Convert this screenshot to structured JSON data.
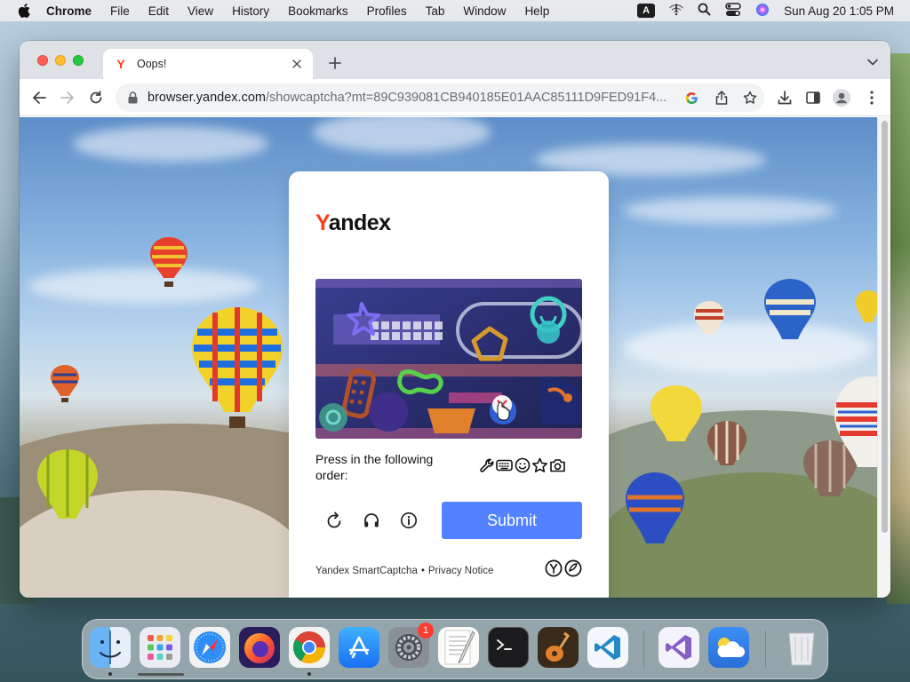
{
  "menubar": {
    "app_name": "Chrome",
    "menus": [
      "File",
      "Edit",
      "View",
      "History",
      "Bookmarks",
      "Profiles",
      "Tab",
      "Window",
      "Help"
    ],
    "input_source": "A",
    "clock": "Sun Aug 20  1:05 PM"
  },
  "tab": {
    "title": "Oops!",
    "favicon": "Y"
  },
  "address_bar": {
    "host": "browser.yandex.com",
    "path": "/showcaptcha?mt=89C939081CB940185E01AAC85111D9FED91F4..."
  },
  "captcha": {
    "logo_first": "Y",
    "logo_rest": "andex",
    "instruction": "Press in the following order:",
    "order_icons": [
      "wrench-icon",
      "keyboard-icon",
      "smiley-icon",
      "star-icon",
      "camera-icon"
    ],
    "submit_label": "Submit",
    "footer_product": "Yandex SmartCaptcha",
    "footer_separator": "•",
    "footer_privacy": "Privacy Notice"
  },
  "dock": {
    "apps": [
      "Finder",
      "Launchpad",
      "Safari",
      "Firefox",
      "Google Chrome",
      "App Store",
      "System Settings",
      "TextEdit",
      "Terminal",
      "GarageBand",
      "Visual Studio Code",
      "Visual Studio",
      "Weather",
      "Trash"
    ],
    "system_settings_badge": "1"
  },
  "colors": {
    "accent": "#5282ff",
    "yandex_red": "#fc3f1d"
  }
}
